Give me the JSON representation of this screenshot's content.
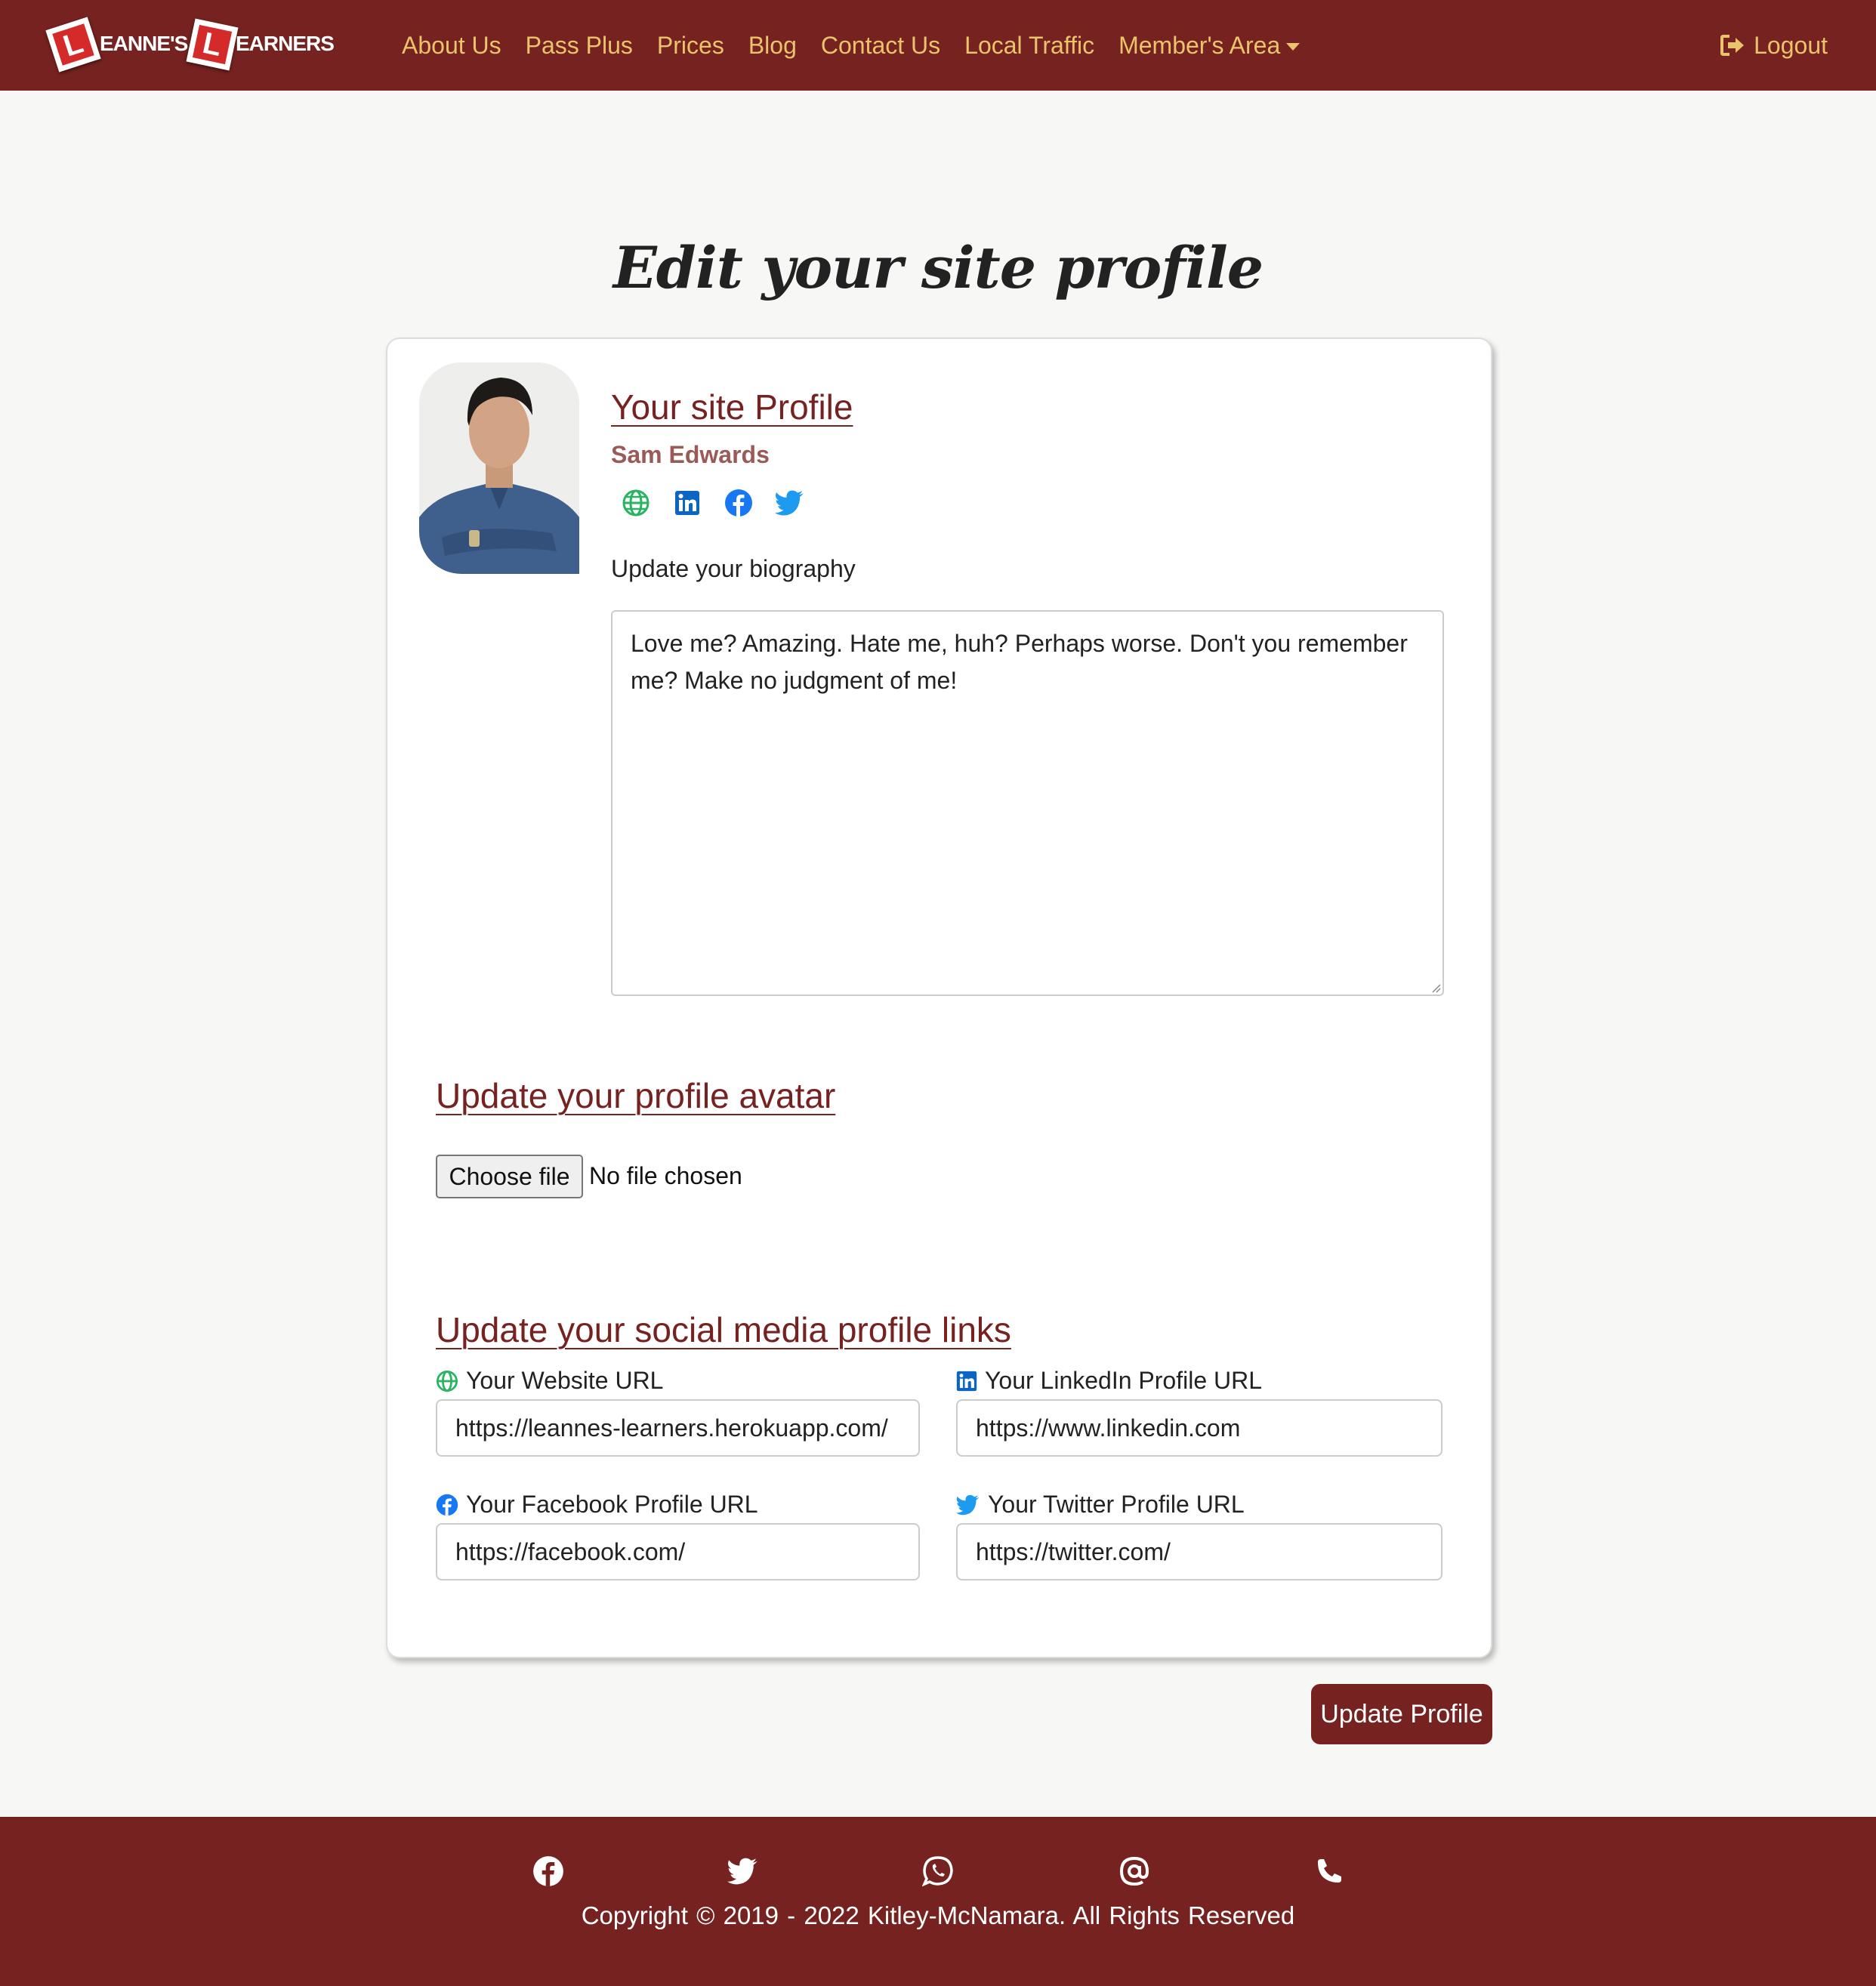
{
  "brand": {
    "part1": "EANNE'S",
    "part2": "EARNERS",
    "plate_letter": "L"
  },
  "nav": {
    "items": [
      {
        "label": "About Us"
      },
      {
        "label": "Pass Plus"
      },
      {
        "label": "Prices"
      },
      {
        "label": "Blog"
      },
      {
        "label": "Contact Us"
      },
      {
        "label": "Local Traffic"
      },
      {
        "label": "Member's Area"
      }
    ],
    "logout_label": "Logout"
  },
  "page": {
    "title": "Edit your site profile"
  },
  "profile": {
    "heading": "Your site Profile",
    "name": "Sam Edwards",
    "social_icons": [
      "globe-icon",
      "linkedin-icon",
      "facebook-icon",
      "twitter-icon"
    ],
    "bio_label": "Update your biography",
    "bio_text": "Love me? Amazing. Hate me, huh? Perhaps worse. Don't you remember me? Make no judgment of me!"
  },
  "avatar_section": {
    "heading": "Update your profile avatar",
    "choose_file_label": "Choose file",
    "file_status": "No file chosen"
  },
  "social_section": {
    "heading": "Update your social media profile links",
    "website_label": "Your Website URL",
    "website_value": "https://leannes-learners.herokuapp.com/",
    "linkedin_label": "Your LinkedIn Profile URL",
    "linkedin_value": "https://www.linkedin.com",
    "facebook_label": "Your Facebook Profile URL",
    "facebook_value": "https://facebook.com/",
    "twitter_label": "Your Twitter Profile URL",
    "twitter_value": "https://twitter.com/"
  },
  "actions": {
    "update_label": "Update Profile"
  },
  "footer": {
    "icons": [
      "facebook-icon",
      "twitter-icon",
      "whatsapp-icon",
      "at-icon",
      "phone-icon"
    ],
    "copyright": "Copyright © 2019 - 2022  Kitley-McNamara.  All Rights Reserved"
  },
  "colors": {
    "brand": "#752220",
    "nav_link": "#e9c46a",
    "background": "#f7f7f5"
  }
}
